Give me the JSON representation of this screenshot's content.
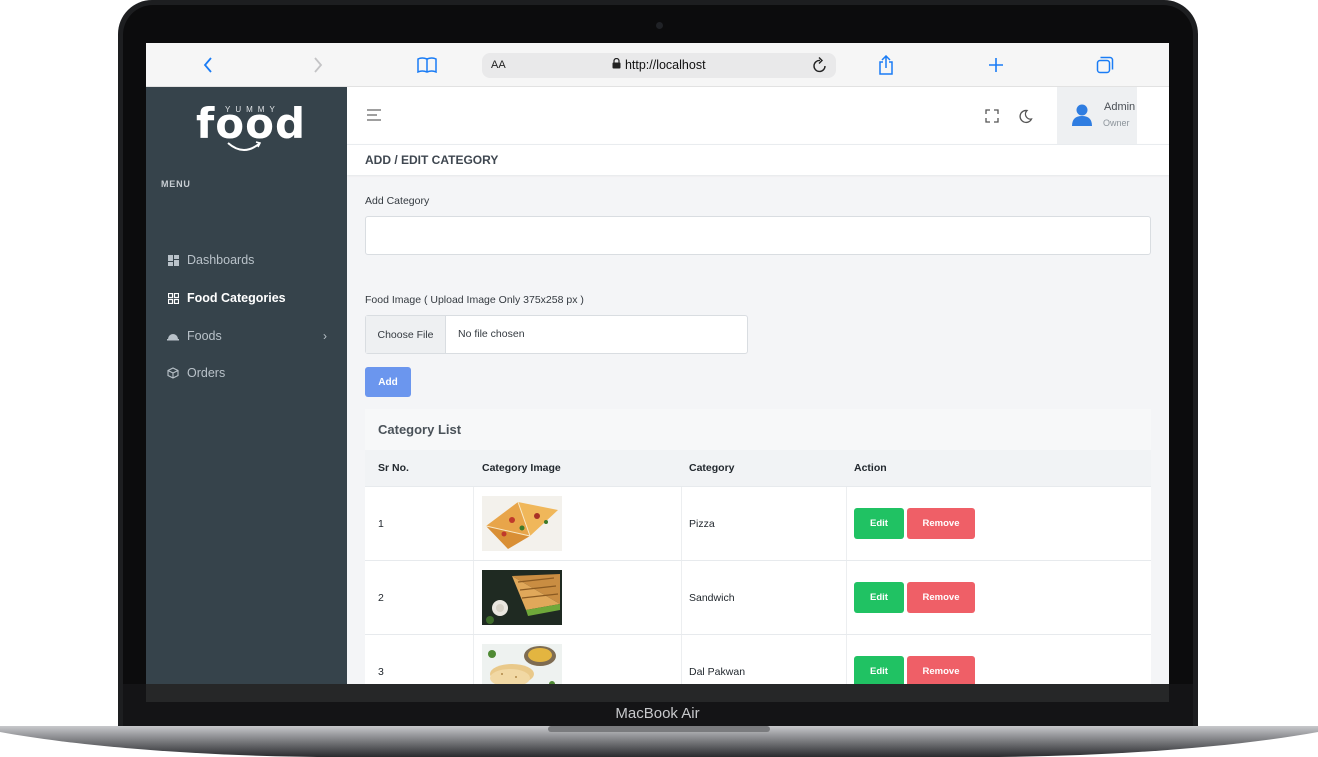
{
  "device": {
    "label": "MacBook Air"
  },
  "browser": {
    "reader_label": "AA",
    "url": "http://localhost"
  },
  "sidebar": {
    "brand_main": "food",
    "brand_top": "YUMMY",
    "menu_title": "MENU",
    "items": [
      {
        "label": "Dashboards",
        "icon": "dashboard-icon",
        "active": false
      },
      {
        "label": "Food Categories",
        "icon": "grid-icon",
        "active": true
      },
      {
        "label": "Foods",
        "icon": "cloche-icon",
        "active": false,
        "has_submenu": true
      },
      {
        "label": "Orders",
        "icon": "box-icon",
        "active": false
      }
    ]
  },
  "topbar": {
    "user_name": "Admin",
    "user_role": "Owner"
  },
  "page": {
    "title": "ADD / EDIT CATEGORY"
  },
  "form": {
    "category_label": "Add Category",
    "category_value": "",
    "image_label": "Food Image ( Upload Image Only 375x258 px )",
    "file_button": "Choose File",
    "file_status": "No file chosen",
    "submit_label": "Add"
  },
  "table": {
    "title": "Category List",
    "headers": [
      "Sr No.",
      "Category Image",
      "Category",
      "Action"
    ],
    "rows": [
      {
        "sr": "1",
        "category": "Pizza",
        "edit": "Edit",
        "remove": "Remove"
      },
      {
        "sr": "2",
        "category": "Sandwich",
        "edit": "Edit",
        "remove": "Remove"
      },
      {
        "sr": "3",
        "category": "Dal Pakwan",
        "edit": "Edit",
        "remove": "Remove"
      }
    ]
  },
  "colors": {
    "sidebar_bg": "#36434b",
    "primary": "#6b96ee",
    "edit": "#20c263",
    "remove": "#ef5f67"
  }
}
